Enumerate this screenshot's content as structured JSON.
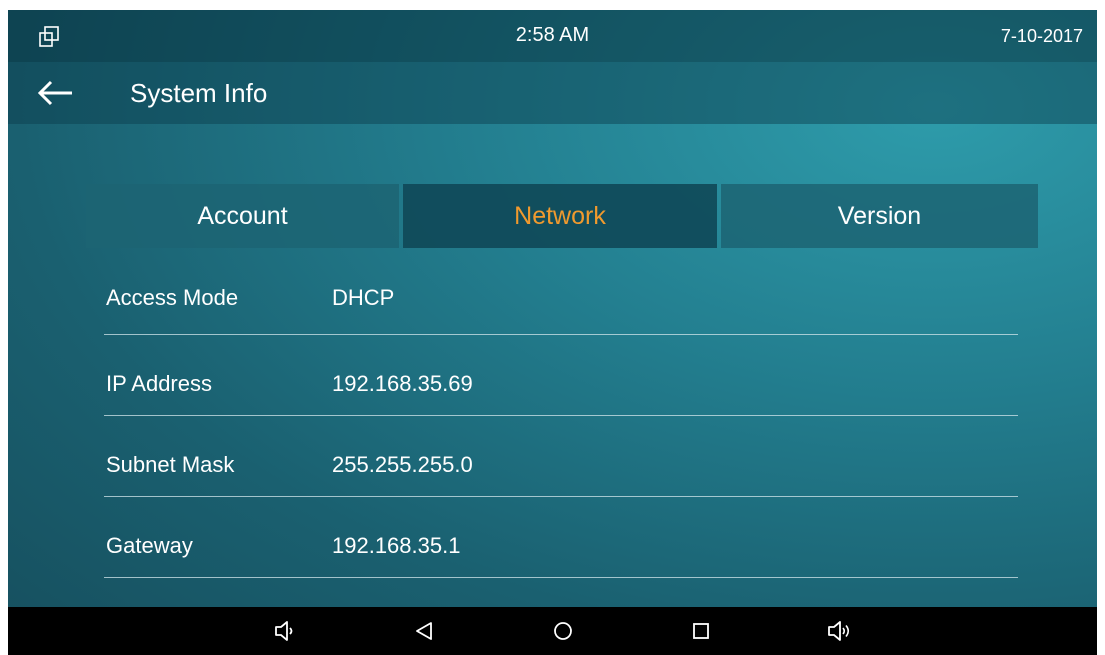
{
  "status_bar": {
    "time": "2:58 AM",
    "date": "7-10-2017",
    "left_icon": "multi-window-icon"
  },
  "header": {
    "back_icon": "back-arrow-icon",
    "title": "System Info"
  },
  "tabs": [
    {
      "label": "Account",
      "active": false
    },
    {
      "label": "Network",
      "active": true
    },
    {
      "label": "Version",
      "active": false
    }
  ],
  "network_info": [
    {
      "label": "Access Mode",
      "value": "DHCP"
    },
    {
      "label": "IP Address",
      "value": "192.168.35.69"
    },
    {
      "label": "Subnet Mask",
      "value": "255.255.255.0"
    },
    {
      "label": "Gateway",
      "value": "192.168.35.1"
    }
  ],
  "nav_bar": {
    "buttons": [
      "volume-down-icon",
      "back-triangle-icon",
      "home-circle-icon",
      "recent-apps-square-icon",
      "volume-up-icon"
    ]
  },
  "colors": {
    "active_tab_text": "#f09a2e",
    "background": "#237f90",
    "nav_bar": "#000000"
  }
}
